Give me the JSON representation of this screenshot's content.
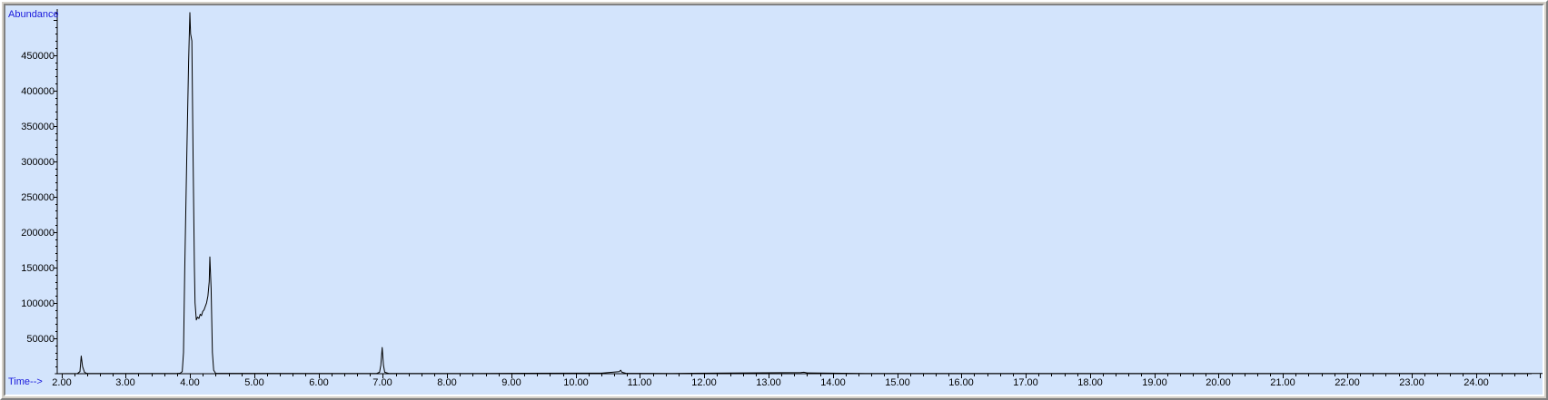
{
  "chart_data": {
    "type": "line",
    "title": "",
    "xlabel": "Time-->",
    "ylabel": "Abundance",
    "xlim": [
      1.9,
      25.1
    ],
    "ylim": [
      0,
      515000
    ],
    "grid": false,
    "x_ticks": [
      2.0,
      3.0,
      4.0,
      5.0,
      6.0,
      7.0,
      8.0,
      9.0,
      10.0,
      11.0,
      12.0,
      13.0,
      14.0,
      15.0,
      16.0,
      17.0,
      18.0,
      19.0,
      20.0,
      21.0,
      22.0,
      23.0,
      24.0
    ],
    "x_tick_labels": [
      "2.00",
      "3.00",
      "4.00",
      "5.00",
      "6.00",
      "7.00",
      "8.00",
      "9.00",
      "10.00",
      "11.00",
      "12.00",
      "13.00",
      "14.00",
      "15.00",
      "16.00",
      "17.00",
      "18.00",
      "19.00",
      "20.00",
      "21.00",
      "22.00",
      "23.00",
      "24.00"
    ],
    "y_ticks": [
      50000,
      100000,
      150000,
      200000,
      250000,
      300000,
      350000,
      400000,
      450000
    ],
    "y_tick_labels": [
      "50000",
      "100000",
      "150000",
      "200000",
      "250000",
      "300000",
      "350000",
      "400000",
      "450000"
    ],
    "line_color": "#000000",
    "background_color": "#d3e4fc",
    "label_color": "#1a1adc",
    "series": [
      {
        "x": [
          1.9,
          2.25,
          2.29,
          2.31,
          2.33,
          2.36,
          2.4,
          3.8,
          3.85,
          3.88,
          3.9,
          3.92,
          3.95,
          3.98,
          4.0,
          4.01,
          4.03,
          4.05,
          4.07,
          4.08,
          4.1,
          4.12,
          4.14,
          4.16,
          4.18,
          4.2,
          4.22,
          4.24,
          4.26,
          4.28,
          4.3,
          4.31,
          4.33,
          4.35,
          4.37,
          4.4,
          6.9,
          6.95,
          6.97,
          6.99,
          7.01,
          7.03,
          7.1,
          8.5,
          9.2,
          10.4,
          10.68,
          10.7,
          10.72,
          10.78,
          11.5,
          13.5,
          13.55,
          13.6,
          14.5,
          25.1
        ],
        "y": [
          0,
          200,
          3000,
          25000,
          10000,
          2000,
          200,
          300,
          800,
          3000,
          30000,
          150000,
          300000,
          440000,
          510000,
          480000,
          470000,
          300000,
          150000,
          100000,
          76000,
          80000,
          78000,
          84000,
          82000,
          88000,
          90000,
          95000,
          100000,
          110000,
          130000,
          165000,
          120000,
          30000,
          5000,
          500,
          300,
          2000,
          12000,
          37000,
          12000,
          2000,
          300,
          400,
          600,
          800,
          3000,
          5000,
          2000,
          700,
          400,
          1500,
          2000,
          1200,
          300,
          200
        ]
      }
    ]
  }
}
